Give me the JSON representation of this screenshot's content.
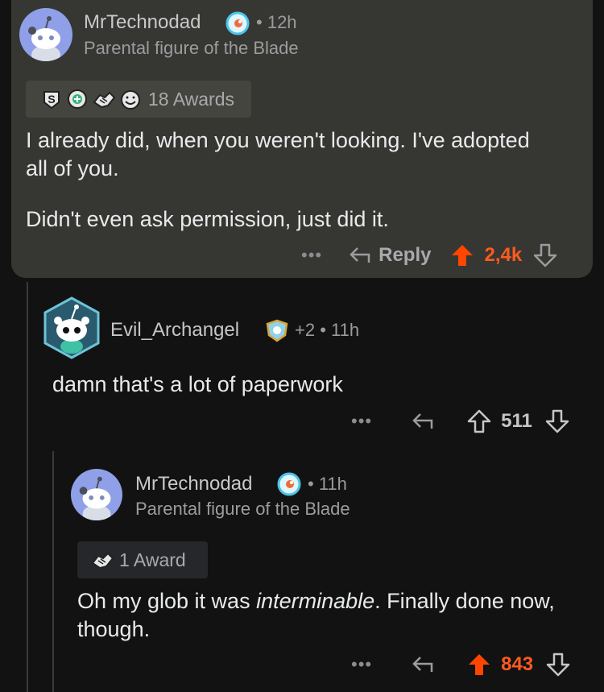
{
  "comments": [
    {
      "username": "MrTechnodad",
      "time": "12h",
      "flair": "Parental figure of the Blade",
      "awards_label": "18 Awards",
      "body": [
        "I already did, when you weren't looking. I've adopted all of you.",
        "Didn't even ask permission, just did it."
      ],
      "reply_label": "Reply",
      "score": "2,4k",
      "upvoted": true
    },
    {
      "username": "Evil_Archangel",
      "karma_badge": "+2",
      "time": "11h",
      "body": [
        "damn that's a lot of paperwork"
      ],
      "score": "511",
      "upvoted": false
    },
    {
      "username": "MrTechnodad",
      "time": "11h",
      "flair": "Parental figure of the Blade",
      "awards_label": "1 Award",
      "body_prefix": "Oh my glob it was ",
      "body_italic": "interminable",
      "body_suffix": ". Finally done now, though.",
      "score": "843",
      "upvoted": true
    }
  ],
  "separator": "•",
  "more_label": "•••",
  "colors": {
    "upvote": "#ff4500",
    "card": "#363733",
    "background": "#121212"
  }
}
